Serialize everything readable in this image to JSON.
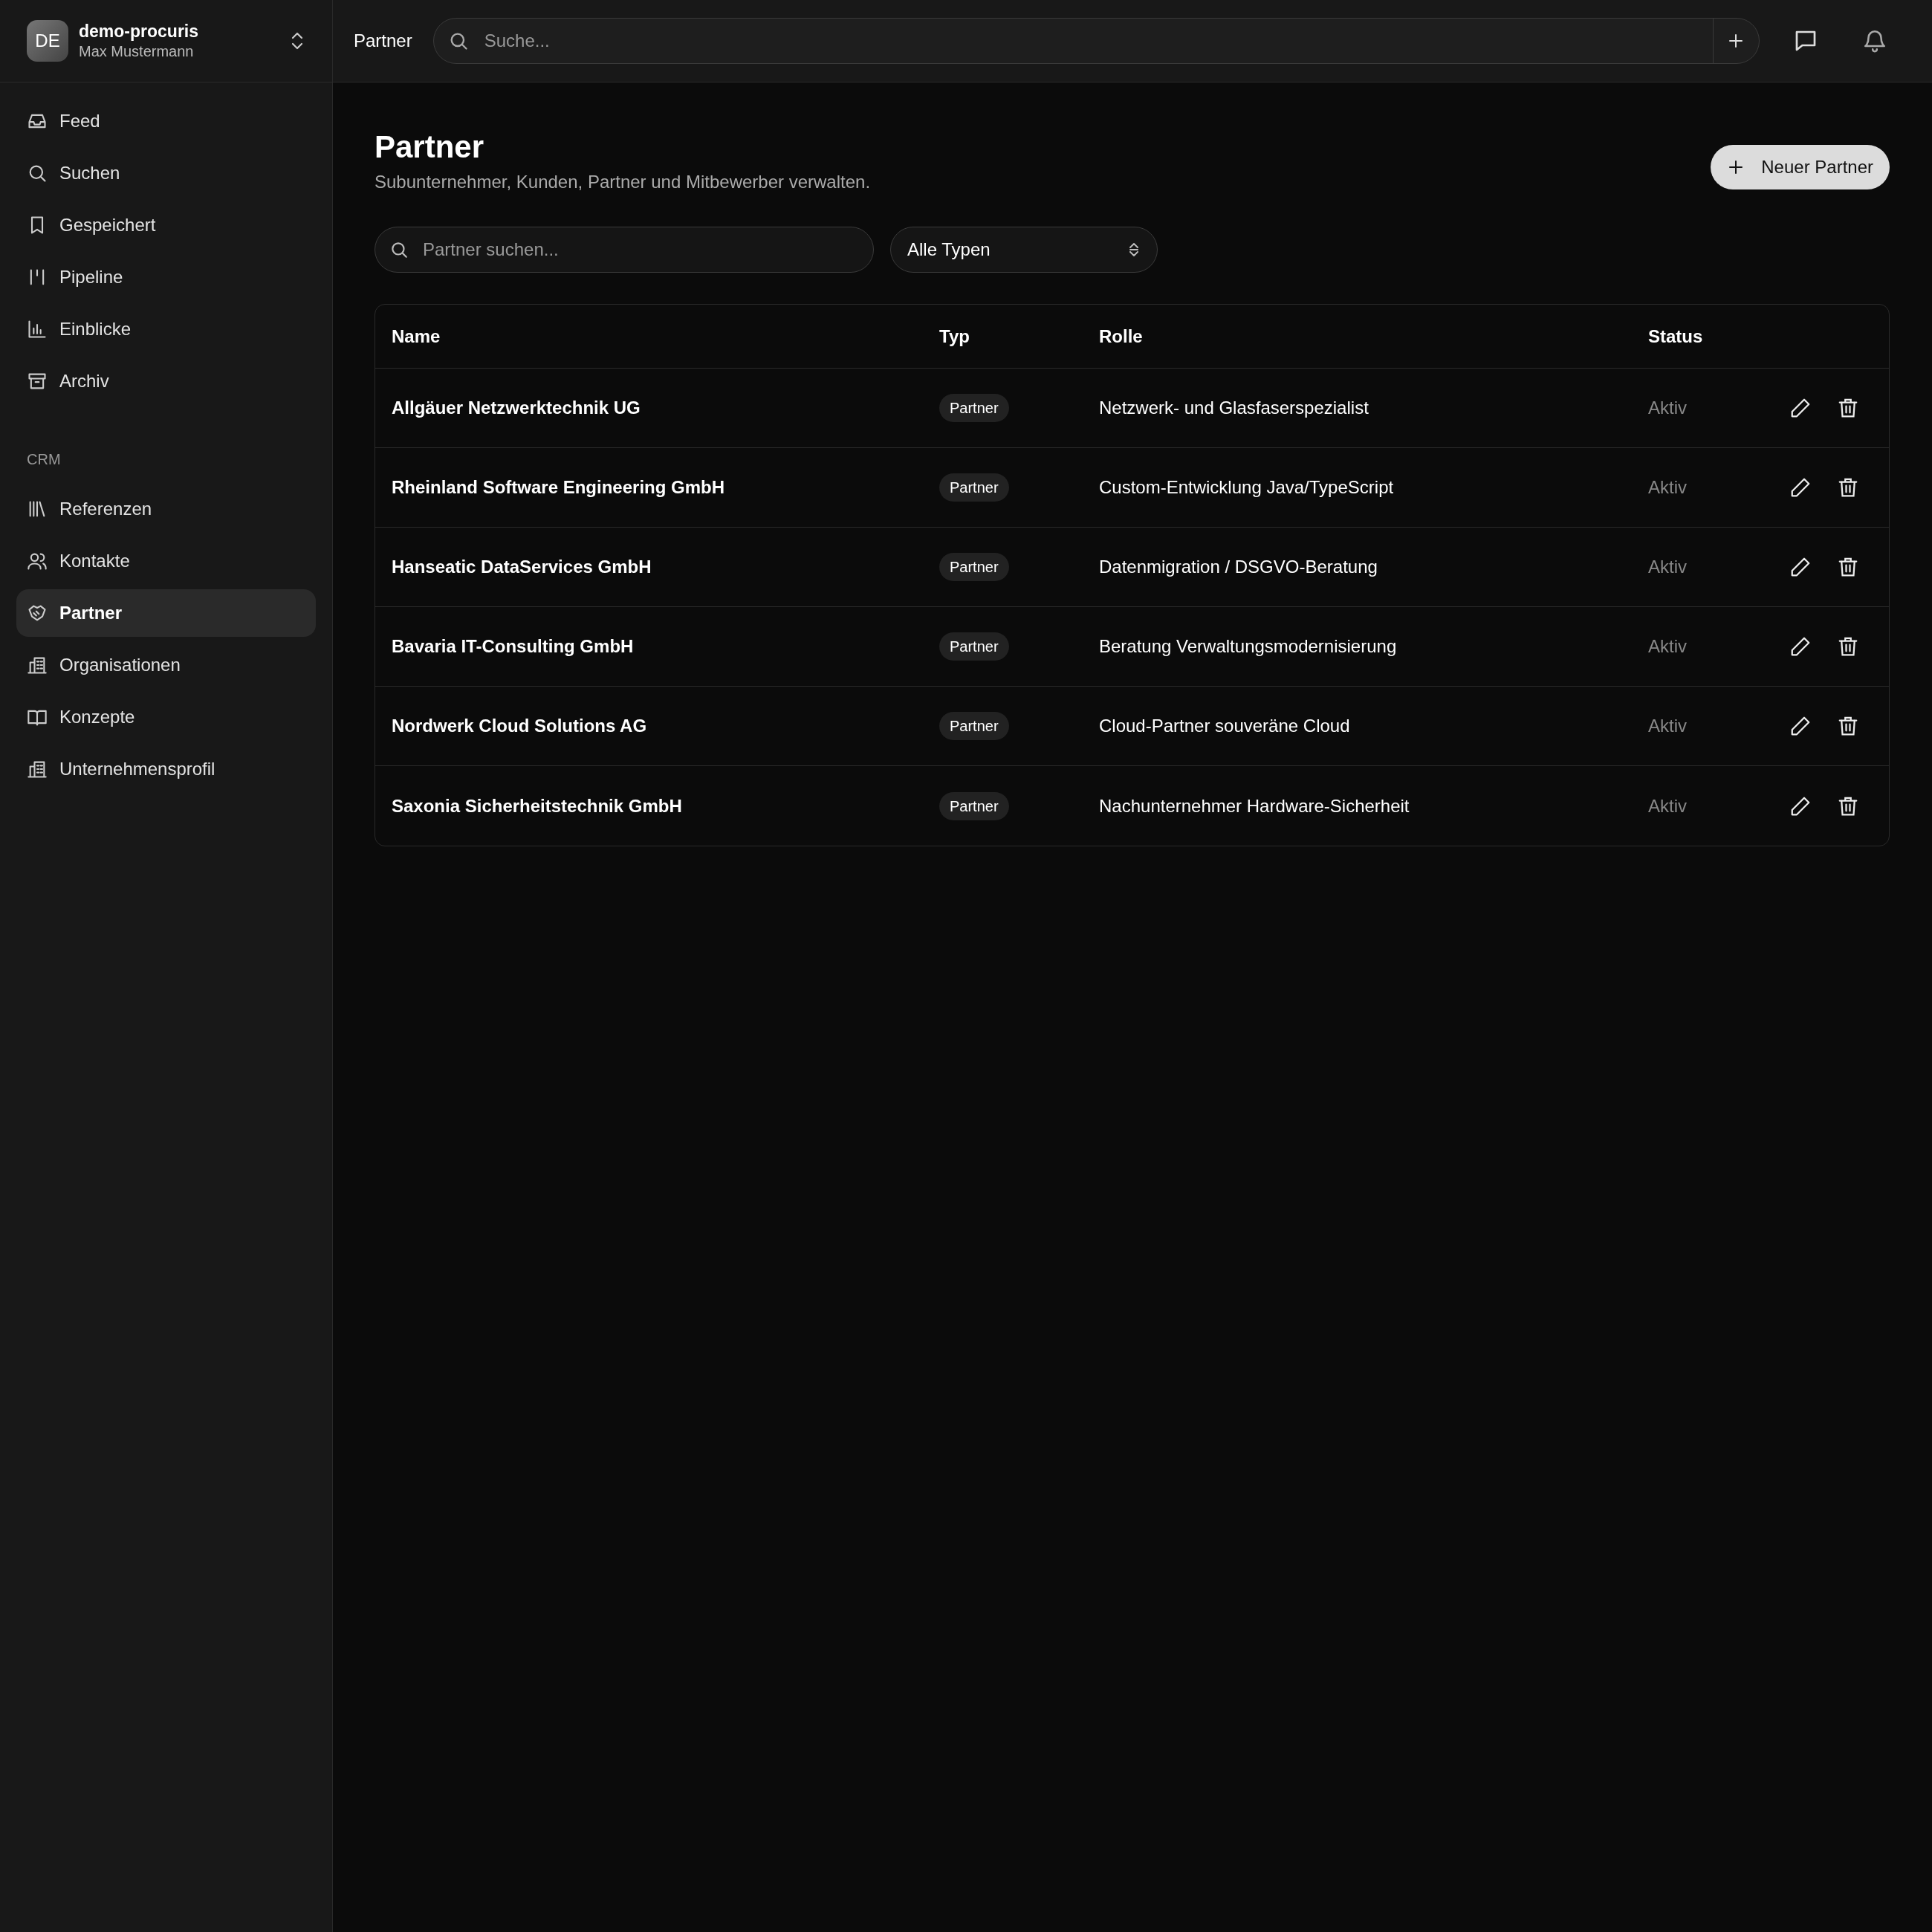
{
  "workspace": {
    "avatar": "DE",
    "name": "demo-procuris",
    "user": "Max Mustermann"
  },
  "header": {
    "breadcrumb": "Partner",
    "search": {
      "placeholder": "Suche..."
    }
  },
  "sidebar": {
    "items": [
      {
        "label": "Feed",
        "selected": false
      },
      {
        "label": "Suchen",
        "selected": false
      },
      {
        "label": "Gespeichert",
        "selected": false
      },
      {
        "label": "Pipeline",
        "selected": false
      },
      {
        "label": "Einblicke",
        "selected": false
      },
      {
        "label": "Archiv",
        "selected": false
      }
    ],
    "sections": [
      {
        "title": "CRM",
        "items": [
          {
            "label": "Referenzen",
            "selected": false
          },
          {
            "label": "Kontakte",
            "selected": false
          },
          {
            "label": "Partner",
            "selected": true
          },
          {
            "label": "Organisationen",
            "selected": false
          },
          {
            "label": "Konzepte",
            "selected": false
          },
          {
            "label": "Unternehmensprofil",
            "selected": false
          }
        ]
      }
    ]
  },
  "page": {
    "title": "Partner",
    "subtitle": "Subunternehmer, Kunden, Partner und Mitbewerber verwalten.",
    "new_button": "Neuer Partner",
    "search": {
      "placeholder": "Partner suchen..."
    },
    "type_filter": "Alle Typen"
  },
  "table": {
    "columns": [
      "Name",
      "Typ",
      "Rolle",
      "Status"
    ],
    "rows": [
      {
        "name": "Allgäuer Netzwerktechnik UG",
        "type": "Partner",
        "role": "Netzwerk- und Glasfaserspezialist",
        "status": "Aktiv"
      },
      {
        "name": "Rheinland Software Engineering GmbH",
        "type": "Partner",
        "role": "Custom-Entwicklung Java/TypeScript",
        "status": "Aktiv"
      },
      {
        "name": "Hanseatic DataServices GmbH",
        "type": "Partner",
        "role": "Datenmigration / DSGVO-Beratung",
        "status": "Aktiv"
      },
      {
        "name": "Bavaria IT-Consulting GmbH",
        "type": "Partner",
        "role": "Beratung Verwaltungsmodernisierung",
        "status": "Aktiv"
      },
      {
        "name": "Nordwerk Cloud Solutions AG",
        "type": "Partner",
        "role": "Cloud-Partner souveräne Cloud",
        "status": "Aktiv"
      },
      {
        "name": "Saxonia Sicherheitstechnik GmbH",
        "type": "Partner",
        "role": "Nachunternehmer Hardware-Sicherheit",
        "status": "Aktiv"
      }
    ]
  }
}
